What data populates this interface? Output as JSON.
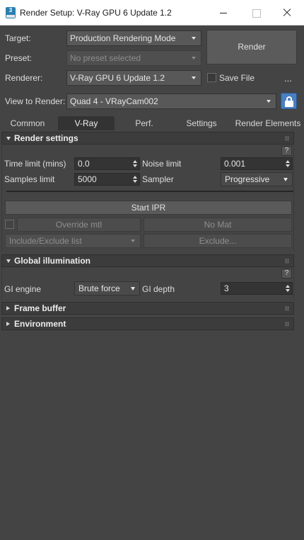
{
  "window": {
    "title": "Render Setup: V-Ray GPU 6 Update 1.2",
    "app_icon_label": "3"
  },
  "top": {
    "target_label": "Target:",
    "target_value": "Production Rendering Mode",
    "preset_label": "Preset:",
    "preset_placeholder": "No preset selected",
    "renderer_label": "Renderer:",
    "renderer_value": "V-Ray GPU 6 Update 1.2",
    "save_file_label": "Save File",
    "more_label": "...",
    "view_label": "View to Render:",
    "view_value": "Quad 4 - VRayCam002",
    "render_label": "Render"
  },
  "tabs": [
    {
      "label": "Common",
      "active": false
    },
    {
      "label": "V-Ray",
      "active": true
    },
    {
      "label": "Perf.",
      "active": false
    },
    {
      "label": "Settings",
      "active": false
    },
    {
      "label": "Render Elements",
      "active": false
    }
  ],
  "render_settings": {
    "title": "Render settings",
    "help": "?",
    "time_limit_label": "Time limit (mins)",
    "time_limit_value": "0.0",
    "noise_limit_label": "Noise limit",
    "noise_limit_value": "0.001",
    "samples_limit_label": "Samples limit",
    "samples_limit_value": "5000",
    "sampler_label": "Sampler",
    "sampler_value": "Progressive",
    "start_ipr": "Start IPR",
    "override_mtl": "Override mtl",
    "no_mat": "No Mat",
    "include_exclude": "Include/Exclude list",
    "exclude": "Exclude..."
  },
  "global_illumination": {
    "title": "Global illumination",
    "help": "?",
    "gi_engine_label": "GI engine",
    "gi_engine_value": "Brute force",
    "gi_depth_label": "GI depth",
    "gi_depth_value": "3"
  },
  "frame_buffer": {
    "title": "Frame buffer"
  },
  "environment": {
    "title": "Environment"
  },
  "colors": {
    "accent_lock": "#4a7fc0",
    "panel_bg": "#444444",
    "titlebar_bg": "#ffffff"
  }
}
